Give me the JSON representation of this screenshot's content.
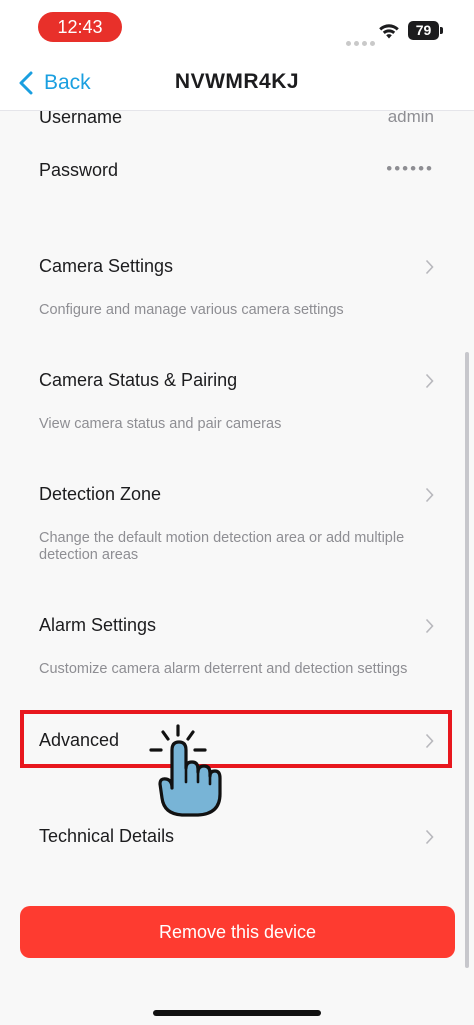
{
  "status_bar": {
    "time": "12:43",
    "battery": "79"
  },
  "nav": {
    "back_label": "Back",
    "title": "NVWMR4KJ"
  },
  "account": {
    "username_label": "Username",
    "username_value": "admin",
    "password_label": "Password",
    "password_value": "••••••"
  },
  "settings": [
    {
      "title": "Camera Settings",
      "description": "Configure and manage various camera settings"
    },
    {
      "title": "Camera Status & Pairing",
      "description": "View camera status and pair cameras"
    },
    {
      "title": "Detection Zone",
      "description": "Change the default motion detection area or add multiple detection areas"
    },
    {
      "title": "Alarm Settings",
      "description": "Customize camera alarm deterrent and detection settings"
    },
    {
      "title": "Advanced",
      "description": ""
    },
    {
      "title": "Technical Details",
      "description": ""
    }
  ],
  "remove_button_label": "Remove this device",
  "colors": {
    "accent": "#1a9fe0",
    "destructive": "#fe3b30",
    "highlight": "#e8171e",
    "time_pill": "#e8302a"
  },
  "icons": [
    "wifi-icon",
    "battery-icon",
    "back-chevron-icon",
    "chevron-right-icon",
    "tap-hand-icon"
  ]
}
